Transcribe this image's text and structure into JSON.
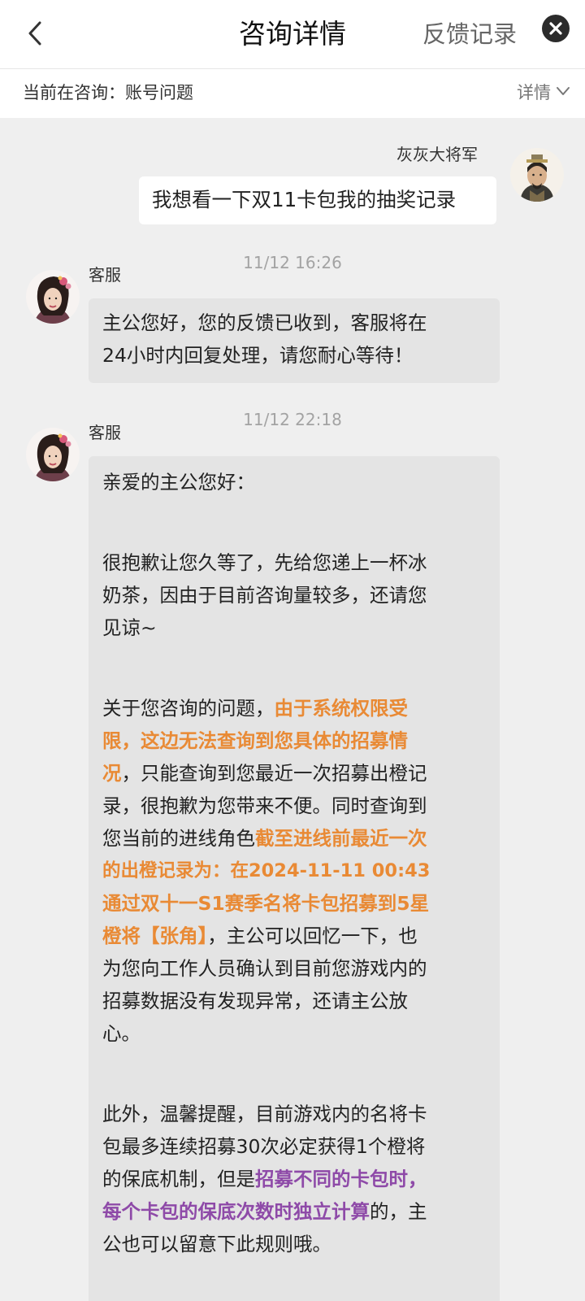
{
  "header": {
    "title": "咨询详情",
    "feedback_link": "反馈记录"
  },
  "subbar": {
    "current_topic": "当前在咨询：账号问题",
    "details_label": "详情"
  },
  "messages": [
    {
      "sender": "灰灰大将军",
      "text": "我想看一下双11卡包我的抽奖记录"
    },
    {
      "time": "11/12 16:26",
      "sender": "客服",
      "lines": [
        "主公您好，您的反馈已收到，客服将在",
        "24小时内回复处理，请您耐心等待！"
      ]
    },
    {
      "time": "11/12 22:18",
      "sender": "客服",
      "greeting": "亲爱的主公您好：",
      "para1_lines": [
        "很抱歉让您久等了，先给您递上一杯冰",
        "奶茶，因由于目前咨询量较多，还请您",
        "见谅~"
      ],
      "para2": {
        "l1_a": "关于您咨询的问题，",
        "l1_b": "由于系统权限受",
        "l2": "限，这边无法查询到您具体的招募情",
        "l3_a": "况",
        "l3_b": "，只能查询到您最近一次招募出橙记",
        "l4": "录，很抱歉为您带来不便。同时查询到",
        "l5_a": "您当前的进线角色",
        "l5_b": "截至进线前最近一次",
        "l6": "的出橙记录为：在2024-11-11 00:43",
        "l7": "通过双十一S1赛季名将卡包招募到5星",
        "l8_a": "橙将【张角】",
        "l8_b": "，主公可以回忆一下，也",
        "l9": "为您向工作人员确认到目前您游戏内的",
        "l10": "招募数据没有发现异常，还请主公放",
        "l11": "心。"
      },
      "para3": {
        "l1": "此外，温馨提醒，目前游戏内的名将卡",
        "l2": "包最多连续招募30次必定获得1个橙将",
        "l3_a": "的保底机制，但是",
        "l3_b": "招募不同的卡包时，",
        "l4_a": "每个卡包的保底次数时独立计算",
        "l4_b": "的，主",
        "l5": "公也可以留意下此规则哦。"
      }
    }
  ],
  "colors": {
    "highlight_orange": "#e98a35",
    "highlight_purple": "#8e4aa8",
    "agent_bubble": "#e4e4e4",
    "user_bubble": "#ffffff"
  }
}
